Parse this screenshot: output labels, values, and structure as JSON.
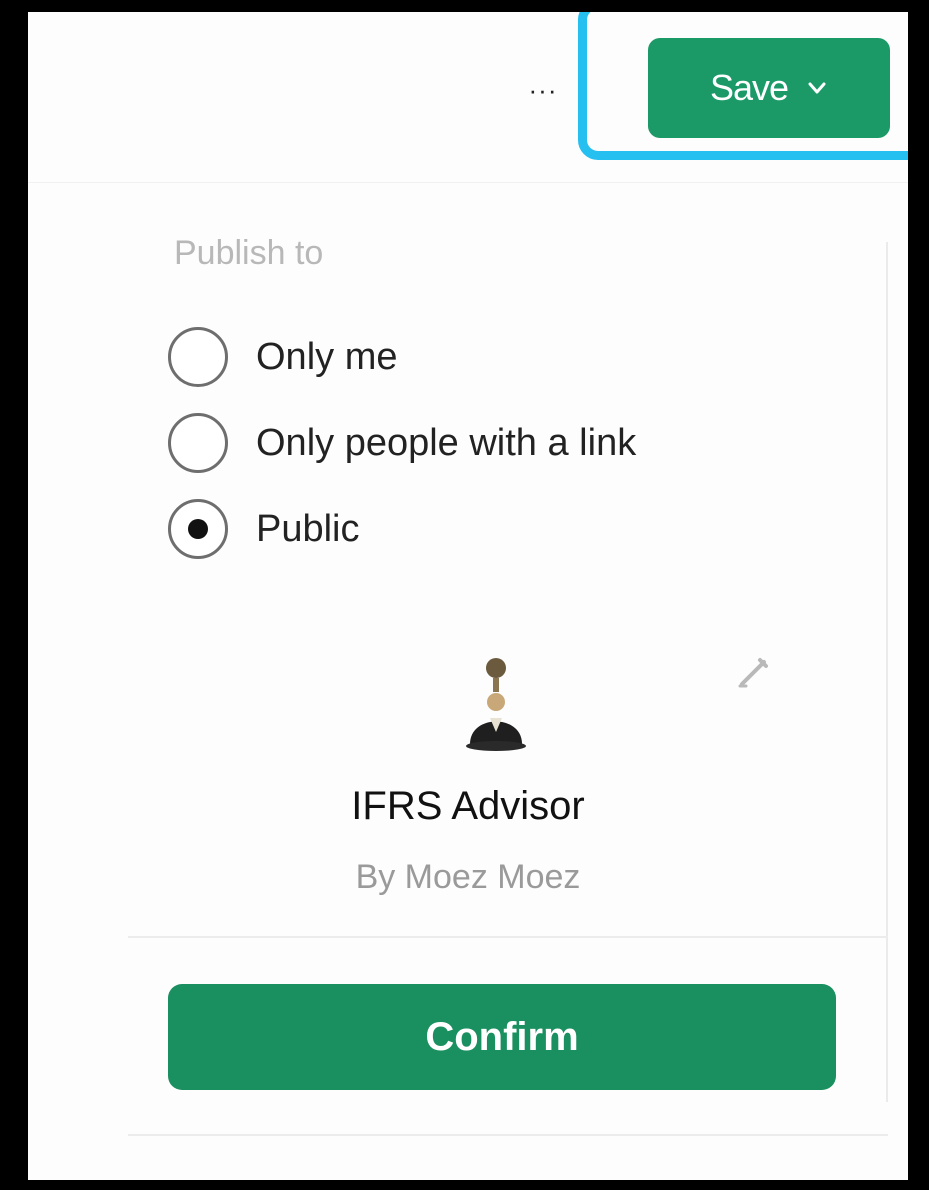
{
  "header": {
    "more_label": "···",
    "save_label": "Save",
    "save_icon": "chevron-down-icon"
  },
  "publish": {
    "label": "Publish to",
    "options": [
      {
        "label": "Only me",
        "selected": false
      },
      {
        "label": "Only people with a link",
        "selected": false
      },
      {
        "label": "Public",
        "selected": true
      }
    ]
  },
  "gpt": {
    "name": "IFRS Advisor",
    "author": "By Moez Moez",
    "avatar_icon": "businessman-avatar-icon",
    "edit_icon": "pencil-edit-icon"
  },
  "footer": {
    "confirm_label": "Confirm"
  },
  "colors": {
    "accent_green": "#1b9a68",
    "highlight_blue": "#25bff0"
  }
}
